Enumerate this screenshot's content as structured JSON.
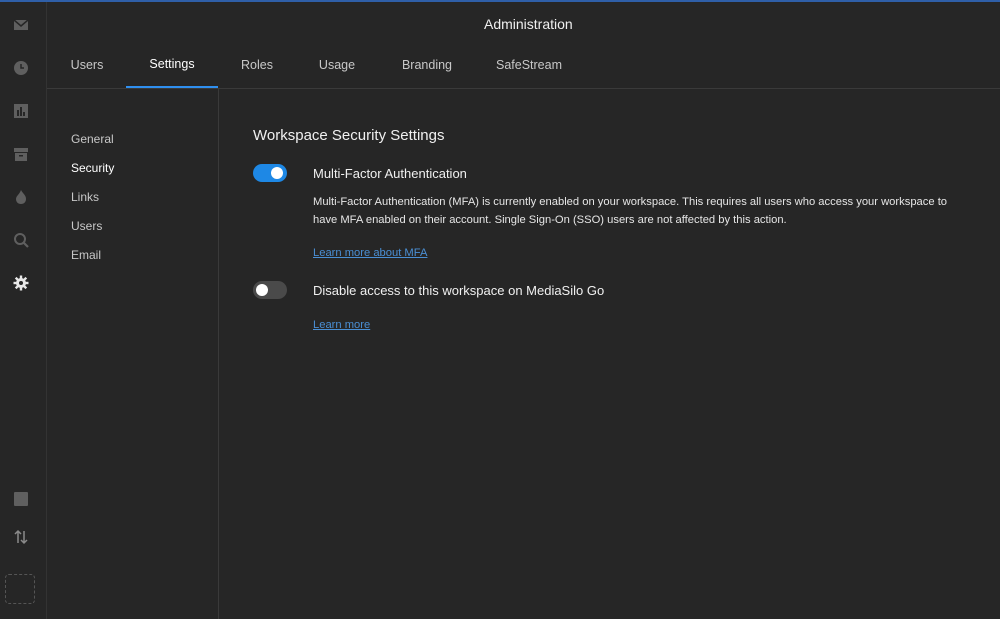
{
  "header": {
    "title": "Administration"
  },
  "rail": {
    "icons": [
      "mail-icon",
      "clock-icon",
      "bar-chart-icon",
      "archive-icon",
      "flame-icon",
      "search-icon",
      "gear-icon",
      "square-icon",
      "sort-arrows-icon"
    ]
  },
  "tabs": [
    {
      "label": "Users"
    },
    {
      "label": "Settings"
    },
    {
      "label": "Roles"
    },
    {
      "label": "Usage"
    },
    {
      "label": "Branding"
    },
    {
      "label": "SafeStream"
    }
  ],
  "subnav": [
    {
      "label": "General"
    },
    {
      "label": "Security"
    },
    {
      "label": "Links"
    },
    {
      "label": "Users"
    },
    {
      "label": "Email"
    }
  ],
  "security": {
    "title": "Workspace Security Settings",
    "mfa": {
      "label": "Multi-Factor Authentication",
      "enabled": true,
      "description": "Multi-Factor Authentication (MFA) is currently enabled on your workspace. This requires all users who access your workspace to have MFA enabled on their account. Single Sign-On (SSO) users are not affected by this action.",
      "link": "Learn more about MFA"
    },
    "go": {
      "label": "Disable access to this workspace on MediaSilo Go",
      "enabled": false,
      "link": "Learn more"
    }
  },
  "colors": {
    "accent": "#1e88e5",
    "link": "#4a8fd4",
    "background": "#262626"
  }
}
